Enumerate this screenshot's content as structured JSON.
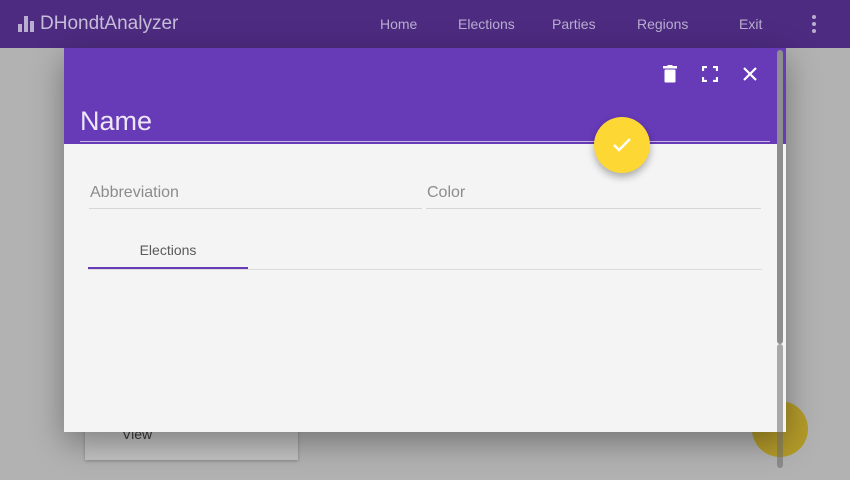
{
  "app": {
    "title": "DHondtAnalyzer",
    "nav": [
      "Home",
      "Elections",
      "Parties",
      "Regions",
      "Exit"
    ]
  },
  "background": {
    "card_action": "View"
  },
  "dialog": {
    "name_placeholder": "Name",
    "abbreviation_placeholder": "Abbreviation",
    "color_placeholder": "Color",
    "tabs": [
      "Elections"
    ]
  },
  "icons": {
    "delete": "trash-icon",
    "fullscreen": "fullscreen-icon",
    "close": "close-icon",
    "confirm": "check-icon",
    "menu": "more-vert-icon"
  },
  "colors": {
    "primary": "#673ab7",
    "accent": "#fdd835"
  }
}
